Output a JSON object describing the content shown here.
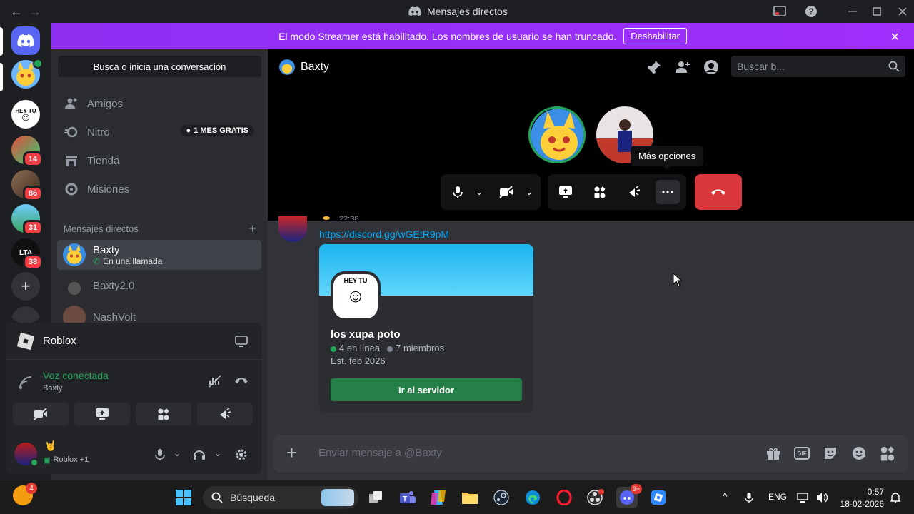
{
  "window": {
    "title": "Mensajes directos",
    "back": "←",
    "forward": "→"
  },
  "banner": {
    "text": "El modo Streamer está habilitado. Los nombres de usuario se han truncado.",
    "button": "Deshabilitar"
  },
  "rail": {
    "badges": [
      "14",
      "86",
      "31",
      "38"
    ],
    "server_text": [
      "HEY TU",
      "LTA"
    ]
  },
  "sidebar": {
    "search": "Busca o inicia una conversación",
    "nav": [
      {
        "label": "Amigos",
        "icon": "friends-icon"
      },
      {
        "label": "Nitro",
        "icon": "nitro-icon",
        "badge": "1 MES GRATIS"
      },
      {
        "label": "Tienda",
        "icon": "shop-icon"
      },
      {
        "label": "Misiones",
        "icon": "quests-icon"
      }
    ],
    "dm_header": "Mensajes directos",
    "dms": [
      {
        "name": "Baxty",
        "status": "En una llamada"
      },
      {
        "name": "Baxty2.0"
      },
      {
        "name": "NashVolt"
      }
    ]
  },
  "voice": {
    "activity": "Roblox",
    "status": "Voz conectada",
    "channel": "Baxty"
  },
  "user": {
    "emoji": "🤘",
    "activity": "Roblox +1"
  },
  "chat": {
    "title": "Baxty",
    "search_placeholder": "Buscar b...",
    "tooltip": "Más opciones",
    "timestamp": "22:38",
    "link": "https://discord.gg/wGEtR9pM",
    "invite": {
      "icon_text": "HEY TU",
      "server_name": "los xupa poto",
      "online": "4 en línea",
      "members": "7 miembros",
      "established": "Est. feb 2026",
      "join": "Ir al servidor"
    },
    "composer_placeholder": "Enviar mensaje a @Baxty",
    "gif_label": "GIF"
  },
  "taskbar": {
    "search": "Búsqueda",
    "weather_badge": "4",
    "discord_badge": "9+",
    "lang": "ENG",
    "time": "0:57",
    "date": "18-02-2026"
  },
  "colors": {
    "accent": "#5865f2",
    "banner": "#9b30ff",
    "online": "#23a55a",
    "danger": "#da373c",
    "link": "#00a8fc"
  }
}
